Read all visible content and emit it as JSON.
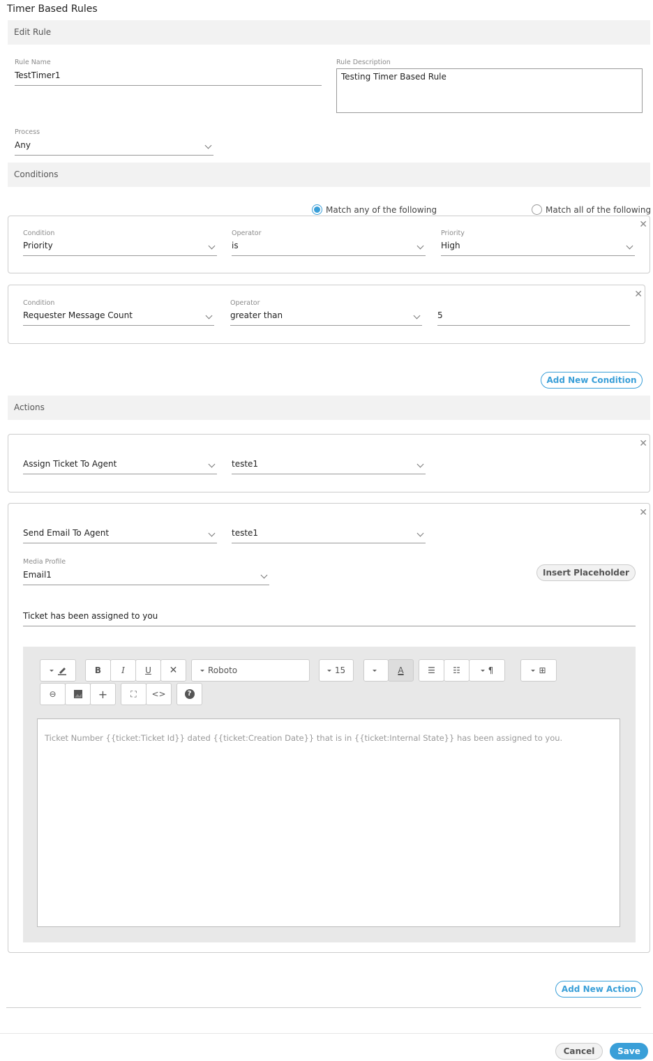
{
  "page": {
    "title": "Timer Based Rules"
  },
  "sections": {
    "edit_rule": "Edit Rule",
    "conditions": "Conditions",
    "actions": "Actions"
  },
  "rule": {
    "name_label": "Rule Name",
    "name_value": "TestTimer1",
    "description_label": "Rule Description",
    "description_value": "Testing Timer Based Rule",
    "process_label": "Process",
    "process_value": "Any"
  },
  "match": {
    "any_label": "Match any of the following",
    "all_label": "Match all of the following",
    "selected": "any"
  },
  "conditions": [
    {
      "condition_label": "Condition",
      "condition_value": "Priority",
      "operator_label": "Operator",
      "operator_value": "is",
      "value_label": "Priority",
      "value_value": "High"
    },
    {
      "condition_label": "Condition",
      "condition_value": "Requester Message Count",
      "operator_label": "Operator",
      "operator_value": "greater than",
      "value_value": "5"
    }
  ],
  "add_condition_label": "Add New Condition",
  "actions": [
    {
      "action_value": "Assign Ticket To Agent",
      "target_value": "teste1"
    },
    {
      "action_value": "Send Email To Agent",
      "target_value": "teste1",
      "media_profile_label": "Media Profile",
      "media_profile_value": "Email1",
      "insert_placeholder_label": "Insert Placeholder",
      "subject_value": "Ticket has been assigned to you",
      "editor": {
        "font_name": "Roboto",
        "font_size": "15",
        "body": "Ticket Number {{ticket:Ticket Id}} dated {{ticket:Creation Date}} that is in {{ticket:Internal State}} has been assigned to you.",
        "toolbar_row1": [
          "style-pen",
          "bold",
          "italic",
          "underline",
          "clear-format",
          "font-name",
          "font-size",
          "color-dropdown",
          "text-color",
          "unordered-list",
          "ordered-list",
          "paragraph",
          "table"
        ],
        "toolbar_row2": [
          "link",
          "picture",
          "insert-hr",
          "fullscreen",
          "code-view",
          "help"
        ]
      }
    }
  ],
  "add_action_label": "Add New Action",
  "footer": {
    "cancel_label": "Cancel",
    "save_label": "Save"
  },
  "colors": {
    "accent": "#3a9fd8",
    "section_bg": "#f2f2f2",
    "editor_bg": "#e8e8e8"
  }
}
